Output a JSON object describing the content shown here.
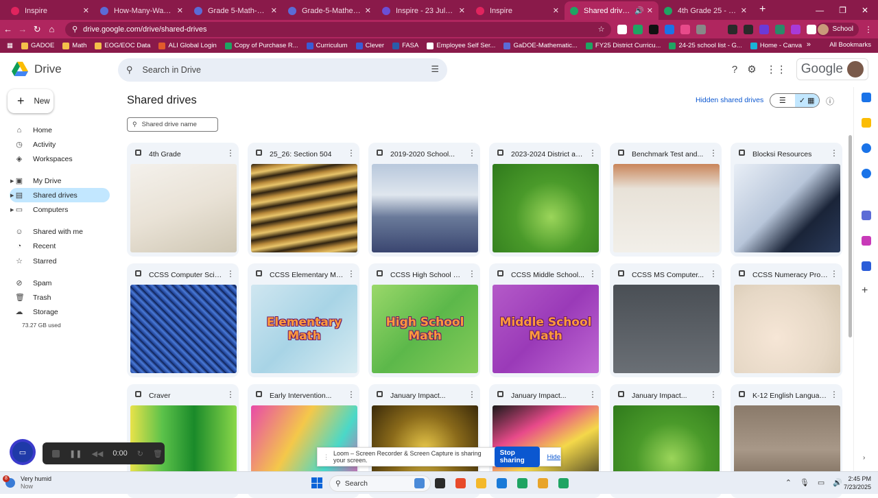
{
  "browser": {
    "tabs": [
      {
        "label": "Inspire",
        "color": "#e0245e"
      },
      {
        "label": "How-Many-Ways-Grade-",
        "color": "#5b6bd6"
      },
      {
        "label": "Grade 5-Math-CGLO",
        "color": "#5b6bd6"
      },
      {
        "label": "Grade-5-Mathematics-C",
        "color": "#5b6bd6"
      },
      {
        "label": "Inspire - 23 July 2025",
        "color": "#6b4fd6"
      },
      {
        "label": "Inspire",
        "color": "#e0245e"
      },
      {
        "label": "Shared drives - Goog",
        "color": "#1fa463",
        "active": true
      },
      {
        "label": "4th Grade 25 - 26 Math",
        "color": "#1fa463"
      }
    ],
    "url": "drive.google.com/drive/shared-drives",
    "profile_label": "School",
    "bookmarks": [
      {
        "label": "GADOE",
        "color": "#f4c04a"
      },
      {
        "label": "Math",
        "color": "#f4c04a"
      },
      {
        "label": "EOG/EOC Data",
        "color": "#f4c04a"
      },
      {
        "label": "ALI Global Login",
        "color": "#e25b2b"
      },
      {
        "label": "Copy of Purchase R...",
        "color": "#1fa463"
      },
      {
        "label": "Curriculum",
        "color": "#3a5bd6"
      },
      {
        "label": "Clever",
        "color": "#3a5bd6"
      },
      {
        "label": "FASA",
        "color": "#2a5caa"
      },
      {
        "label": "Employee Self Ser...",
        "color": "#fff"
      },
      {
        "label": "GaDOE-Mathematic...",
        "color": "#5b6bd6"
      },
      {
        "label": "FY25 District Curricu...",
        "color": "#1fa463"
      },
      {
        "label": "24-25 school list - G...",
        "color": "#1fa463"
      },
      {
        "label": "Home - Canva",
        "color": "#1ab2d6"
      }
    ],
    "all_bookmarks_label": "All Bookmarks"
  },
  "drive": {
    "logo_label": "Drive",
    "search_placeholder": "Search in Drive",
    "google_label": "Google",
    "new_label": "New",
    "nav": [
      {
        "label": "Home",
        "icon": "home-icon",
        "glyph": "⌂"
      },
      {
        "label": "Activity",
        "icon": "activity-icon",
        "glyph": "◷"
      },
      {
        "label": "Workspaces",
        "icon": "workspaces-icon",
        "glyph": "◈"
      },
      {
        "label": "My Drive",
        "icon": "my-drive-icon",
        "glyph": "▣"
      },
      {
        "label": "Shared drives",
        "icon": "shared-drives-icon",
        "glyph": "▤"
      },
      {
        "label": "Computers",
        "icon": "computers-icon",
        "glyph": "▭"
      },
      {
        "label": "Shared with me",
        "icon": "shared-with-me-icon",
        "glyph": "☺"
      },
      {
        "label": "Recent",
        "icon": "recent-icon",
        "glyph": "◔"
      },
      {
        "label": "Starred",
        "icon": "starred-icon",
        "glyph": "☆"
      },
      {
        "label": "Spam",
        "icon": "spam-icon",
        "glyph": "⊘"
      },
      {
        "label": "Trash",
        "icon": "trash-icon",
        "glyph": "🗑"
      },
      {
        "label": "Storage",
        "icon": "storage-icon",
        "glyph": "☁"
      }
    ],
    "storage_used": "73.27 GB used",
    "page_title": "Shared drives",
    "hidden_link": "Hidden shared drives",
    "filter_placeholder": "Shared drive name",
    "drives": [
      {
        "name": "4th Grade",
        "thumb": "linear-gradient(160deg,#f4f1ec 0%,#e9e2d6 50%,#cfc7b4 100%)",
        "text": ""
      },
      {
        "name": "25_26: Section 504",
        "thumb": "repeating-linear-gradient(170deg,#2a1f10 0px,#b8893a 8px,#e8c46a 14px,#3a2a12 22px)",
        "text": ""
      },
      {
        "name": "2019-2020 School...",
        "thumb": "linear-gradient(180deg,#b8c8dc 0%,#dfe6ee 35%,#6a7a9a 60%,#3a4670 100%)",
        "text": ""
      },
      {
        "name": "2023-2024 District and...",
        "thumb": "radial-gradient(circle at 55% 60%,#9bd55a 0%,#4a9a2a 45%,#2f7a1c 100%)",
        "text": ""
      },
      {
        "name": "Benchmark Test and...",
        "thumb": "linear-gradient(180deg,#c9855a 0%,#e8e2d8 28%,#f2efe9 100%)",
        "text": ""
      },
      {
        "name": "Blocksi Resources",
        "thumb": "linear-gradient(135deg,#e8eef6 0%,#b8c6da 45%,#1a2438 70%,#2a3a5a 100%)",
        "text": ""
      },
      {
        "name": "CCSS Computer Science",
        "thumb": "repeating-linear-gradient(45deg,#1a3a8a 0px,#4a7ad8 5px,#0a1a4a 9px)",
        "text": ""
      },
      {
        "name": "CCSS Elementary Math",
        "thumb": "linear-gradient(135deg,#cfe6f0 0%,#a8d4e6 50%,#d8ecf2 100%)",
        "text": "Elementary Math"
      },
      {
        "name": "CCSS High School Math",
        "thumb": "linear-gradient(135deg,#9ad86a 0%,#5cb84a 50%,#86cc5a 100%)",
        "text": "High School Math"
      },
      {
        "name": "CCSS Middle School...",
        "thumb": "linear-gradient(135deg,#b45ac8 0%,#9a3ab8 50%,#c06ad4 100%)",
        "text": "Middle School Math"
      },
      {
        "name": "CCSS MS Computer...",
        "thumb": "linear-gradient(180deg,#4a4f55 0%,#6a6f75 100%)",
        "text": ""
      },
      {
        "name": "CCSS Numeracy Project",
        "thumb": "radial-gradient(circle at 40% 60%,#f6e6d6 0%,#e6d8c6 60%,#d4c6b0 100%)",
        "text": ""
      },
      {
        "name": "Craver",
        "thumb": "linear-gradient(90deg,#e8e24a 0%,#5cc24a 30%,#1a8a2a 60%,#8ad84a 100%)",
        "text": ""
      },
      {
        "name": "Early Intervention...",
        "thumb": "linear-gradient(120deg,#e84aa8 0%,#f4c84a 40%,#4ad8c8 70%,#e84aa8 100%)",
        "text": ""
      },
      {
        "name": "January Impact...",
        "thumb": "radial-gradient(circle at 50% 50%,#e8c84a 0%,#8a6a1a 50%,#3a2a0a 100%)",
        "text": ""
      },
      {
        "name": "January Impact...",
        "thumb": "linear-gradient(150deg,#1a1a1a 0%,#e84a8a 30%,#f4d84a 55%,#1a1a1a 100%)",
        "text": ""
      },
      {
        "name": "January Impact...",
        "thumb": "radial-gradient(circle at 55% 60%,#9bd55a 0%,#4a9a2a 45%,#2f7a1c 100%)",
        "text": ""
      },
      {
        "name": "K-12 English Language...",
        "thumb": "linear-gradient(180deg,#8a7a6a 0%,#a89888 50%,#6a5a4a 100%)",
        "text": ""
      }
    ]
  },
  "loom": {
    "timer": "0:00",
    "message": "Loom – Screen Recorder & Screen Capture is sharing your screen.",
    "stop_label": "Stop sharing",
    "hide_label": "Hide"
  },
  "taskbar": {
    "weather_text": "Very humid",
    "weather_sub": "Now",
    "weather_badge": "8",
    "search_label": "Search",
    "time": "2:45 PM",
    "date": "7/23/2025",
    "apps": [
      "#4a8ad8",
      "#2a2a2a",
      "#e84a2a",
      "#f4b82a",
      "#1a7ad8",
      "#1fa463",
      "#e8a42a",
      "#1fa463"
    ]
  }
}
